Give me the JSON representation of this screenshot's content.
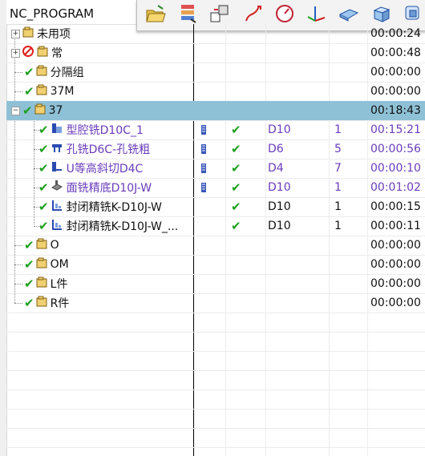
{
  "header": {
    "title": "NC_PROGRAM"
  },
  "toolbar": {
    "icons": [
      "open-folder-icon",
      "list-icon",
      "transform-icon",
      "path-icon",
      "gauge-icon",
      "axis-icon",
      "surface-icon",
      "box-icon",
      "geometry-icon"
    ]
  },
  "rows": [
    {
      "name": "未用项",
      "time": "00:00:24"
    },
    {
      "name": "常",
      "time": "00:00:48"
    },
    {
      "name": "分隔组",
      "time": "00:00:00"
    },
    {
      "name": "37M",
      "time": "00:00:00"
    },
    {
      "name": "37",
      "time": "00:18:43"
    },
    {
      "name": "型腔铣D10C_1",
      "tool": "D10",
      "num": "1",
      "time": "00:15:21"
    },
    {
      "name": "孔铣D6C-孔铣粗",
      "tool": "D6",
      "num": "5",
      "time": "00:00:56"
    },
    {
      "name": "U等高斜切D4C",
      "tool": "D4",
      "num": "7",
      "time": "00:00:10"
    },
    {
      "name": "面铣精底D10J-W",
      "tool": "D10",
      "num": "1",
      "time": "00:01:02"
    },
    {
      "name": "封闭精铣K-D10J-W",
      "tool": "D10",
      "num": "1",
      "time": "00:00:15"
    },
    {
      "name": "封闭精铣K-D10J-W_...",
      "tool": "D10",
      "num": "1",
      "time": "00:00:11"
    },
    {
      "name": "O",
      "time": "00:00:00"
    },
    {
      "name": "OM",
      "time": "00:00:00"
    },
    {
      "name": "L件",
      "time": "00:00:00"
    },
    {
      "name": "R件",
      "time": "00:00:00"
    }
  ],
  "colors": {
    "selected": "#8fc1d6",
    "purple": "#6a3cbc",
    "check": "#1ea01e"
  }
}
